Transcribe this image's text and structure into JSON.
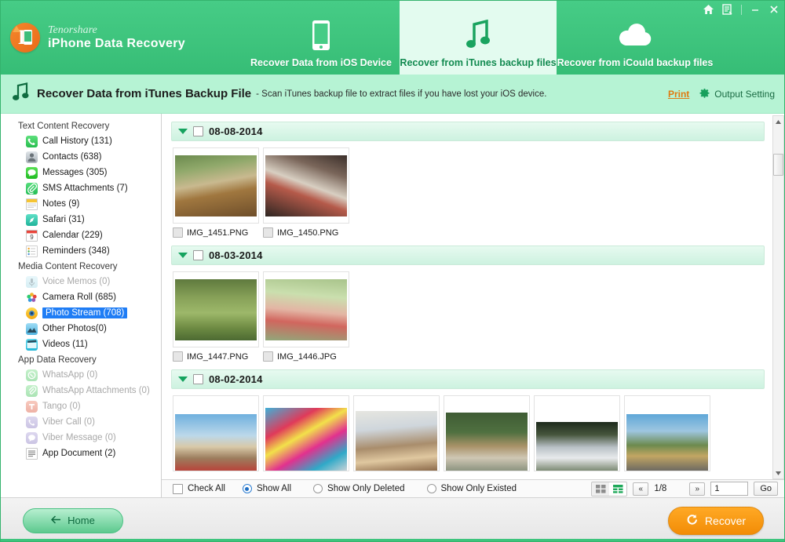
{
  "window": {
    "brand_small": "Tenorshare",
    "brand_large": "iPhone Data Recovery",
    "controls": [
      {
        "name": "home-icon",
        "glyph": "⌂"
      },
      {
        "name": "register-icon",
        "glyph": "☰"
      },
      {
        "name": "minimize-button",
        "glyph": "–"
      },
      {
        "name": "close-button",
        "glyph": "✕"
      }
    ],
    "accent_green": "#3ec47d",
    "accent_orange": "#f28c06"
  },
  "tabs": [
    {
      "label": "Recover Data from iOS Device",
      "icon": "phone-icon",
      "active": false
    },
    {
      "label": "Recover from iTunes backup files",
      "icon": "music-note-icon",
      "active": true
    },
    {
      "label": "Recover from iCould backup files",
      "icon": "cloud-icon",
      "active": false
    }
  ],
  "subheader": {
    "icon": "music-note-icon",
    "title": "Recover Data from iTunes Backup File",
    "description": "- Scan iTunes backup file to extract files if you have lost your iOS device.",
    "print_label": "Print",
    "output_setting_label": "Output Setting"
  },
  "sidebar": {
    "groups": [
      {
        "title": "Text Content Recovery",
        "items": [
          {
            "label": "Call History (131)",
            "icon": "phone-call-icon",
            "color": "#35cc60",
            "disabled": false,
            "selected": false
          },
          {
            "label": "Contacts (638)",
            "icon": "contact-icon",
            "color": "#9aa3ab",
            "disabled": false,
            "selected": false
          },
          {
            "label": "Messages (305)",
            "icon": "message-bubble-icon",
            "color": "#2ecc3f",
            "disabled": false,
            "selected": false
          },
          {
            "label": "SMS Attachments (7)",
            "icon": "paperclip-icon",
            "color": "#2ecc62",
            "disabled": false,
            "selected": false
          },
          {
            "label": "Notes (9)",
            "icon": "notes-icon",
            "color": "#f2c733",
            "disabled": false,
            "selected": false
          },
          {
            "label": "Safari (31)",
            "icon": "safari-compass-icon",
            "color": "#2fc1a8",
            "disabled": false,
            "selected": false
          },
          {
            "label": "Calendar (229)",
            "icon": "calendar-icon",
            "color": "#ffffff",
            "disabled": false,
            "selected": false
          },
          {
            "label": "Reminders (348)",
            "icon": "reminders-icon",
            "color": "#f7f7f7",
            "disabled": false,
            "selected": false
          }
        ]
      },
      {
        "title": "Media Content Recovery",
        "items": [
          {
            "label": "Voice Memos (0)",
            "icon": "microphone-icon",
            "color": "#8fd4e0",
            "disabled": true,
            "selected": false
          },
          {
            "label": "Camera Roll (685)",
            "icon": "photos-flower-icon",
            "color": "#e8573f",
            "disabled": false,
            "selected": false
          },
          {
            "label": "Photo Stream (708)",
            "icon": "photo-stream-icon",
            "color": "#f5a623",
            "disabled": false,
            "selected": true
          },
          {
            "label": "Other Photos(0)",
            "icon": "other-photos-icon",
            "color": "#56c1ea",
            "disabled": false,
            "selected": false
          },
          {
            "label": "Videos (11)",
            "icon": "video-clapper-icon",
            "color": "#35c6e0",
            "disabled": false,
            "selected": false
          }
        ]
      },
      {
        "title": "App Data Recovery",
        "items": [
          {
            "label": "WhatsApp (0)",
            "icon": "whatsapp-icon",
            "color": "#4fce5d",
            "disabled": true,
            "selected": false
          },
          {
            "label": "WhatsApp Attachments (0)",
            "icon": "whatsapp-attachment-icon",
            "color": "#4fce5d",
            "disabled": true,
            "selected": false
          },
          {
            "label": "Tango (0)",
            "icon": "tango-icon",
            "color": "#e8664a",
            "disabled": true,
            "selected": false
          },
          {
            "label": "Viber Call (0)",
            "icon": "viber-call-icon",
            "color": "#8e7fc4",
            "disabled": true,
            "selected": false
          },
          {
            "label": "Viber Message (0)",
            "icon": "viber-message-icon",
            "color": "#8e7fc4",
            "disabled": true,
            "selected": false
          },
          {
            "label": "App Document (2)",
            "icon": "document-icon",
            "color": "#ffffff",
            "disabled": false,
            "selected": false
          }
        ]
      }
    ]
  },
  "content": {
    "groups": [
      {
        "date": "08-08-2014",
        "expanded": true,
        "checked": false,
        "files": [
          {
            "name": "IMG_1451.PNG",
            "checked": false,
            "thumb": "elderly-couple-porch"
          },
          {
            "name": "IMG_1450.PNG",
            "checked": false,
            "thumb": "family-dining-table"
          }
        ]
      },
      {
        "date": "08-03-2014",
        "expanded": true,
        "checked": false,
        "files": [
          {
            "name": "IMG_1447.PNG",
            "checked": false,
            "thumb": "family-park-stroller"
          },
          {
            "name": "IMG_1446.JPG",
            "checked": false,
            "thumb": "two-girls-outdoors"
          }
        ]
      },
      {
        "date": "08-02-2014",
        "expanded": true,
        "checked": false,
        "files": [
          {
            "name": "",
            "checked": false,
            "thumb": "town-square-bus"
          },
          {
            "name": "",
            "checked": false,
            "thumb": "carnival-dancers"
          },
          {
            "name": "",
            "checked": false,
            "thumb": "kids-playroom"
          },
          {
            "name": "",
            "checked": false,
            "thumb": "house-trees-wall"
          },
          {
            "name": "",
            "checked": false,
            "thumb": "suburban-house"
          },
          {
            "name": "",
            "checked": false,
            "thumb": "palm-tree-road"
          }
        ]
      }
    ]
  },
  "toolbar": {
    "check_all_label": "Check All",
    "check_all_checked": false,
    "filters": [
      {
        "label": "Show All",
        "selected": true
      },
      {
        "label": "Show Only Deleted",
        "selected": false
      },
      {
        "label": "Show Only Existed",
        "selected": false
      }
    ],
    "view_modes": [
      {
        "name": "grid-view",
        "active": false
      },
      {
        "name": "detail-view",
        "active": true
      }
    ],
    "prev_label": "«",
    "next_label": "»",
    "page_indicator": "1/8",
    "page_input_value": "1",
    "go_label": "Go"
  },
  "footer": {
    "home_label": "Home",
    "recover_label": "Recover"
  }
}
